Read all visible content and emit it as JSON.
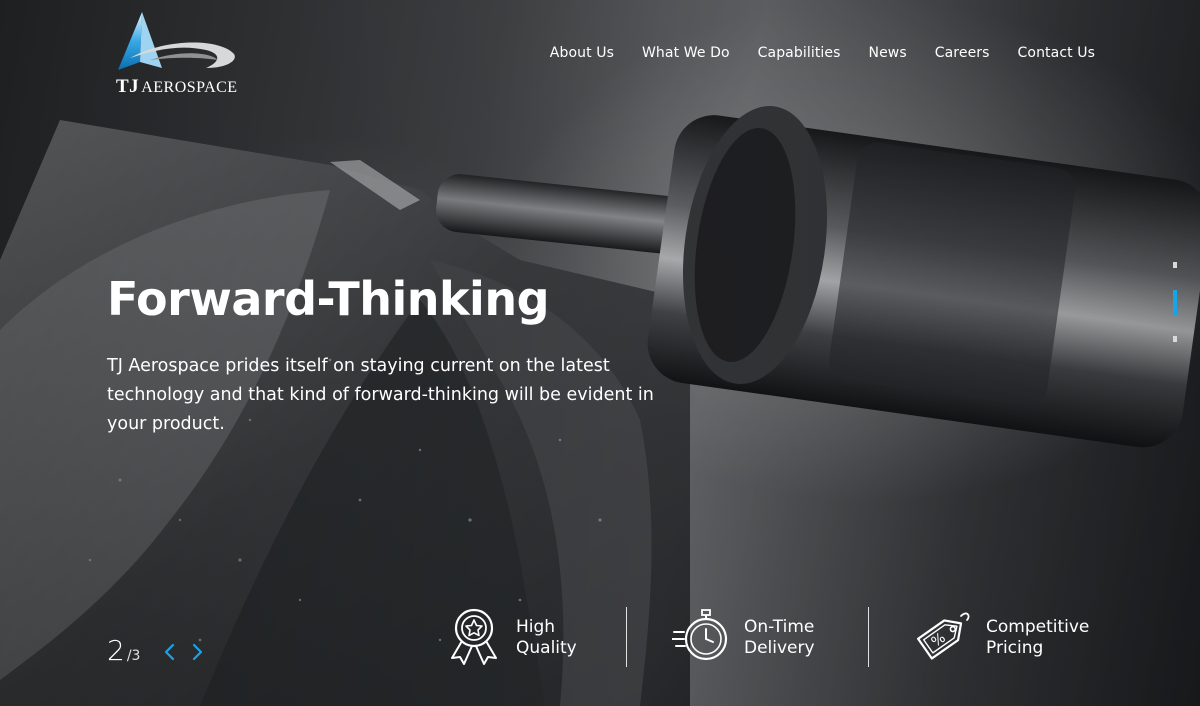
{
  "brand": {
    "logo_initials": "TJ",
    "logo_word": "AEROSPACE",
    "accent": "#1aa3e8"
  },
  "nav": {
    "items": [
      {
        "label": "About Us"
      },
      {
        "label": "What We Do"
      },
      {
        "label": "Capabilities"
      },
      {
        "label": "News"
      },
      {
        "label": "Careers"
      },
      {
        "label": "Contact Us"
      }
    ]
  },
  "hero": {
    "headline": "Forward-Thinking",
    "description": "TJ Aerospace prides itself on staying current on the latest technology and that kind of forward-thinking will be evident in your product."
  },
  "slider": {
    "current": "2",
    "separator": "/",
    "total": "3",
    "active_index": 2,
    "dot_count": 3
  },
  "features": [
    {
      "icon": "award-ribbon-icon",
      "line1": "High",
      "line2": "Quality"
    },
    {
      "icon": "stopwatch-icon",
      "line1": "On-Time",
      "line2": "Delivery"
    },
    {
      "icon": "price-tag-icon",
      "line1": "Competitive",
      "line2": "Pricing"
    }
  ]
}
